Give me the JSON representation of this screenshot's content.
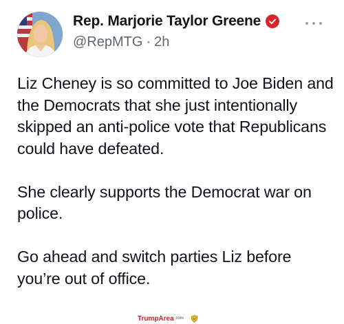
{
  "user": {
    "display_name": "Rep. Marjorie Taylor Greene",
    "handle": "@RepMTG",
    "separator": "·",
    "time": "2h",
    "verified_icon": "verified-check-icon",
    "verified_color": "#d6252c"
  },
  "tweet": {
    "paragraphs": [
      "Liz Cheney is so committed to Joe Biden and the Democrats that she just intentionally skipped an anti-police vote that Republicans could have defeated.",
      "She clearly supports the Democrat war on police.",
      "Go ahead and switch parties Liz before you’re out of office."
    ]
  },
  "actions": {
    "more_icon": "more-options-icon"
  },
  "watermark": {
    "brand": "TrumpArea",
    "suffix": ".com",
    "color": "#c8202e"
  }
}
